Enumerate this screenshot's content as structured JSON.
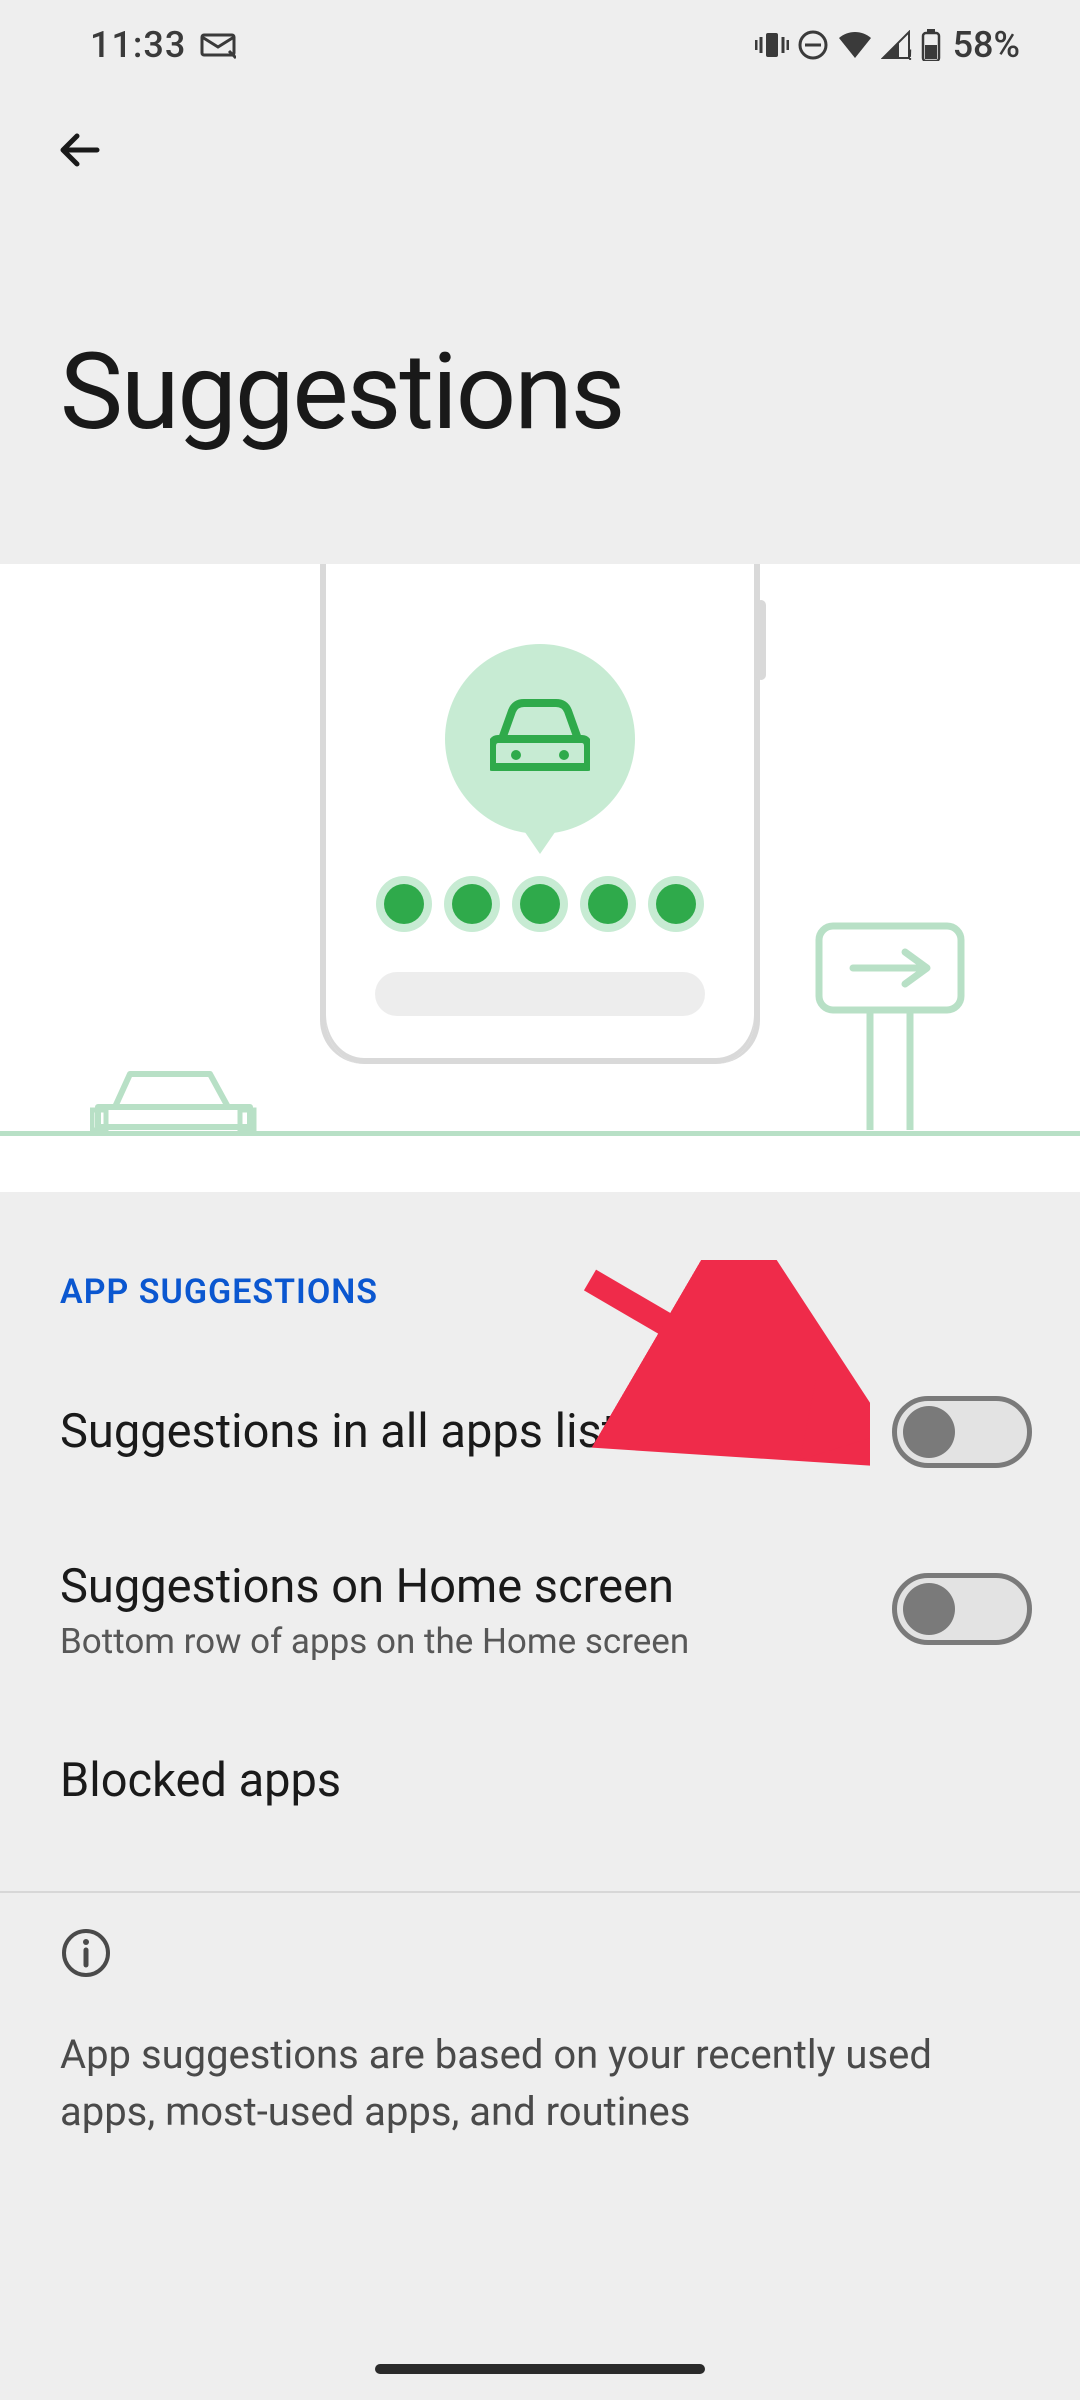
{
  "status": {
    "time": "11:33",
    "battery_pct": "58%"
  },
  "header": {
    "title": "Suggestions"
  },
  "section": {
    "label": "APP SUGGESTIONS"
  },
  "items": [
    {
      "title": "Suggestions in all apps list",
      "subtitle": "",
      "toggle_on": false
    },
    {
      "title": "Suggestions on Home screen",
      "subtitle": "Bottom row of apps on the Home screen",
      "toggle_on": false
    },
    {
      "title": "Blocked apps",
      "subtitle": ""
    }
  ],
  "info": {
    "text": "App suggestions are based on your recently used apps, most-used apps, and routines"
  }
}
